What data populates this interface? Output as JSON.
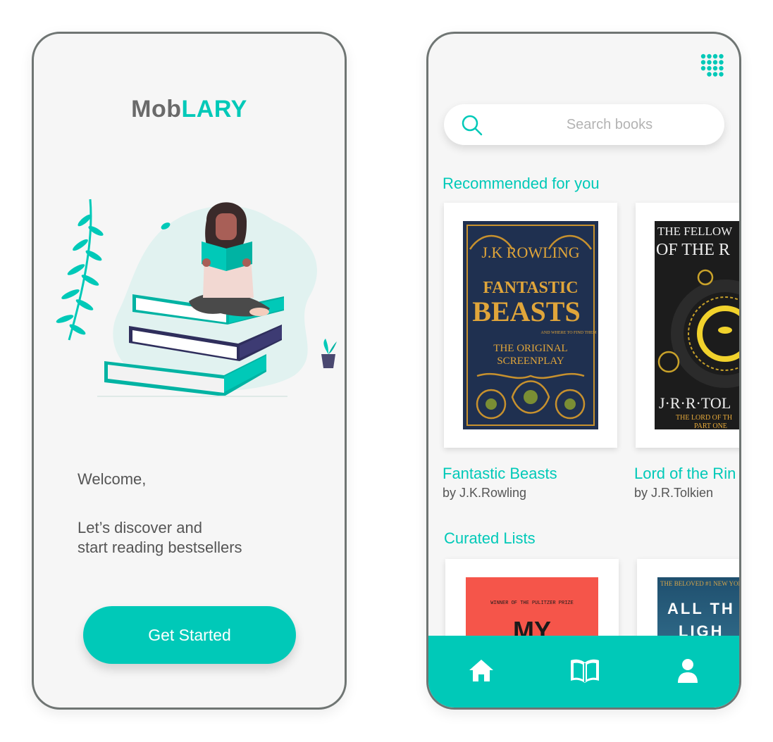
{
  "welcome_screen": {
    "logo_part1": "Mob",
    "logo_part2": "LARY",
    "welcome": "Welcome,",
    "tagline_line1": "Let’s discover and",
    "tagline_line2": "start reading bestsellers",
    "cta_label": "Get Started"
  },
  "home_screen": {
    "search_placeholder": "Search books",
    "recommended_title": "Recommended for you",
    "curated_title": "Curated Lists",
    "books": [
      {
        "title": "Fantastic Beasts",
        "author": "by J.K.Rowling",
        "cover_lines": [
          "J.K ROWLING",
          "FANTASTIC",
          "BEASTS",
          "AND WHERE TO FIND THEM",
          "THE ORIGINAL",
          "SCREENPLAY"
        ]
      },
      {
        "title": "Lord of the Rin",
        "author": "by J.R.Tolkien",
        "cover_lines": [
          "THE FELLOW",
          "OF THE R",
          "J·R·R·TOL",
          "THE LORD OF TH",
          "PART ONE"
        ]
      }
    ],
    "curated": [
      {
        "cover_lines": [
          "WINNER OF THE PULITZER PRIZE",
          "MY"
        ]
      },
      {
        "cover_lines": [
          "THE BELOVED #1 NEW YORK T",
          "ALL TH",
          "LIGH"
        ]
      }
    ]
  },
  "colors": {
    "accent": "#00c9b8",
    "frame": "#6f7573",
    "background": "#f6f6f6"
  },
  "icons": [
    "grid-icon",
    "search-icon",
    "home-icon",
    "book-icon",
    "user-icon"
  ]
}
